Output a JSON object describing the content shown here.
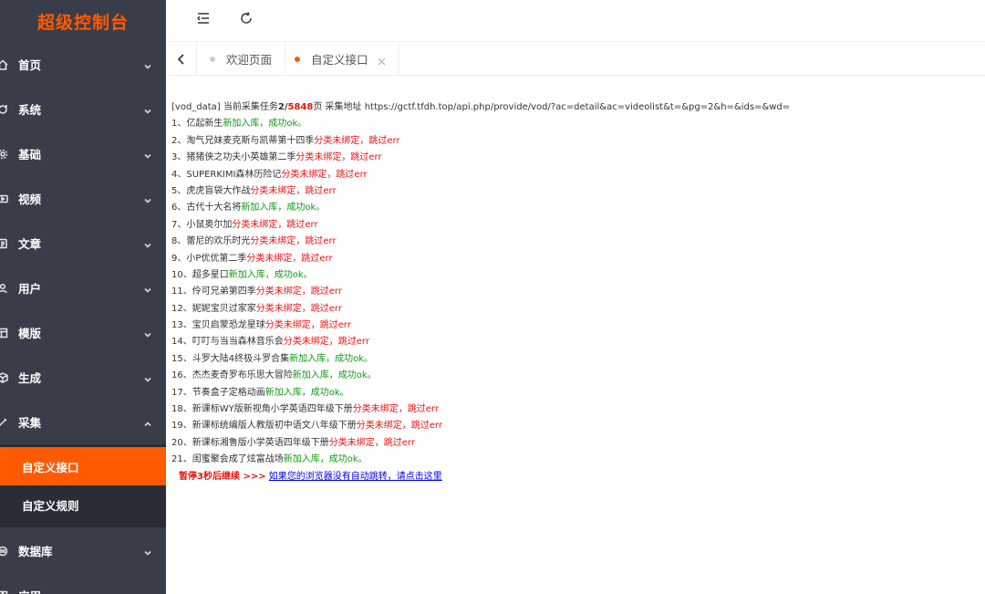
{
  "app": {
    "logo": "超级控制台"
  },
  "sidebar": {
    "items": [
      {
        "label": "首页",
        "icon": "home-icon",
        "expanded": false
      },
      {
        "label": "系统",
        "icon": "settings-icon",
        "expanded": false
      },
      {
        "label": "基础",
        "icon": "gear-icon",
        "expanded": false
      },
      {
        "label": "视频",
        "icon": "video-icon",
        "expanded": false
      },
      {
        "label": "文章",
        "icon": "document-icon",
        "expanded": false
      },
      {
        "label": "用户",
        "icon": "user-icon",
        "expanded": false
      },
      {
        "label": "模版",
        "icon": "template-icon",
        "expanded": false
      },
      {
        "label": "生成",
        "icon": "cube-icon",
        "expanded": false
      },
      {
        "label": "采集",
        "icon": "collect-icon",
        "expanded": true
      },
      {
        "label": "数据库",
        "icon": "database-icon",
        "expanded": false
      },
      {
        "label": "应用",
        "icon": "app-icon",
        "expanded": false
      }
    ],
    "sub_items": [
      {
        "label": "自定义接口",
        "active": true
      },
      {
        "label": "自定义规则",
        "active": false
      }
    ]
  },
  "topbar": {
    "menu_toggle_icon": "menu-fold-icon",
    "refresh_icon": "refresh-icon"
  },
  "tabs": [
    {
      "label": "欢迎页面",
      "active": false,
      "closable": false
    },
    {
      "label": "自定义接口",
      "active": true,
      "closable": true
    }
  ],
  "log": {
    "header": {
      "prefix": "[vod_data] 当前采集任务",
      "current_page": "2",
      "separator": "/",
      "total_pages": "5848",
      "suffix": "页 采集地址 https://gctf.tfdh.top/api.php/provide/vod/?ac=detail&ac=videolist&t=&pg=2&h=&ids=&wd="
    },
    "entries": [
      {
        "index": "1、",
        "title": "亿起新生",
        "status1": "新加入库，",
        "status2": "成功ok。",
        "ok": true
      },
      {
        "index": "2、",
        "title": "淘气兄妹麦克斯与凯蒂第十四季",
        "status1": "分类未绑定，",
        "status2": "跳过err",
        "ok": false
      },
      {
        "index": "3、",
        "title": "猪猪侠之功夫小英雄第二季",
        "status1": "分类未绑定，",
        "status2": "跳过err",
        "ok": false
      },
      {
        "index": "4、",
        "title": "SUPERKIMI森林历险记",
        "status1": "分类未绑定，",
        "status2": "跳过err",
        "ok": false
      },
      {
        "index": "5、",
        "title": "虎虎盲袋大作战",
        "status1": "分类未绑定，",
        "status2": "跳过err",
        "ok": false
      },
      {
        "index": "6、",
        "title": "古代十大名将",
        "status1": "新加入库，",
        "status2": "成功ok。",
        "ok": true
      },
      {
        "index": "7、",
        "title": "小鼠奥尔加",
        "status1": "分类未绑定，",
        "status2": "跳过err",
        "ok": false
      },
      {
        "index": "8、",
        "title": "蕾尼的欢乐时光",
        "status1": "分类未绑定，",
        "status2": "跳过err",
        "ok": false
      },
      {
        "index": "9、",
        "title": "小P优优第二季",
        "status1": "分类未绑定，",
        "status2": "跳过err",
        "ok": false
      },
      {
        "index": "10、",
        "title": "超多星口",
        "status1": "新加入库，",
        "status2": "成功ok。",
        "ok": true
      },
      {
        "index": "11、",
        "title": "伶可兄弟第四季",
        "status1": "分类未绑定，",
        "status2": "跳过err",
        "ok": false
      },
      {
        "index": "12、",
        "title": "妮妮宝贝过家家",
        "status1": "分类未绑定，",
        "status2": "跳过err",
        "ok": false
      },
      {
        "index": "13、",
        "title": "宝贝启蒙恐龙星球",
        "status1": "分类未绑定，",
        "status2": "跳过err",
        "ok": false
      },
      {
        "index": "14、",
        "title": "叮叮与当当森林音乐会",
        "status1": "分类未绑定，",
        "status2": "跳过err",
        "ok": false
      },
      {
        "index": "15、",
        "title": "斗罗大陆4终极斗罗合集",
        "status1": "新加入库，",
        "status2": "成功ok。",
        "ok": true
      },
      {
        "index": "16、",
        "title": "杰杰麦奇罗布乐思大冒险",
        "status1": "新加入库，",
        "status2": "成功ok。",
        "ok": true
      },
      {
        "index": "17、",
        "title": "节奏盒子定格动画",
        "status1": "新加入库，",
        "status2": "成功ok。",
        "ok": true
      },
      {
        "index": "18、",
        "title": "新课标WY版新视角小学英语四年级下册",
        "status1": "分类未绑定，",
        "status2": "跳过err",
        "ok": false
      },
      {
        "index": "19、",
        "title": "新课标统编版人教版初中语文八年级下册",
        "status1": "分类未绑定，",
        "status2": "跳过err",
        "ok": false
      },
      {
        "index": "20、",
        "title": "新课标湘鲁版小学英语四年级下册",
        "status1": "分类未绑定，",
        "status2": "跳过err",
        "ok": false
      },
      {
        "index": "21、",
        "title": "闺蜜聚会成了炫富战场",
        "status1": "新加入库，",
        "status2": "成功ok。",
        "ok": true
      }
    ],
    "pause_text": "暂停3秒后继续 >>>",
    "redirect_link": "如果您的浏览器没有自动跳转，请点击这里"
  },
  "colors": {
    "sidebar_bg": "#393d49",
    "submenu_bg": "#2a2d35",
    "accent": "#ff5a00",
    "ok": "#119911",
    "err": "#ee1111",
    "link": "#0000ee"
  }
}
